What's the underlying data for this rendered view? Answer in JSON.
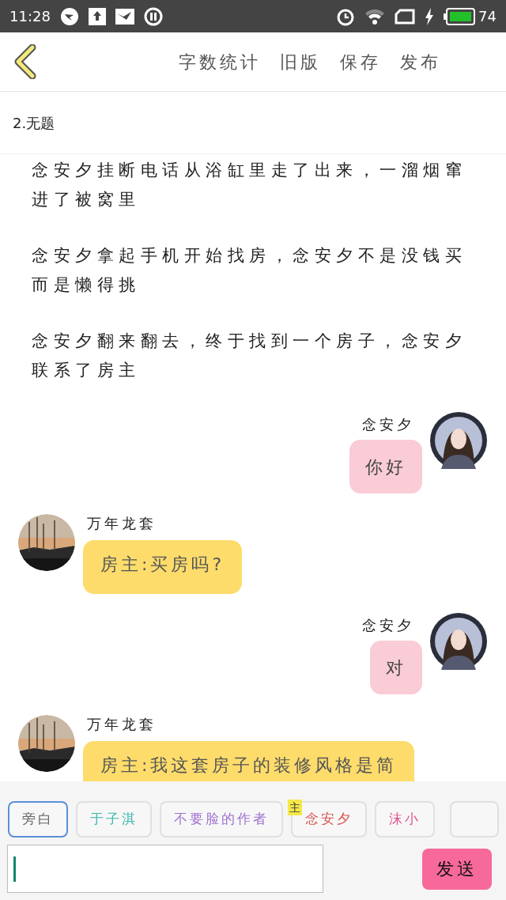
{
  "status_bar": {
    "time": "11:28",
    "battery": "74"
  },
  "toolbar": {
    "actions": [
      "字数统计",
      "旧版",
      "保存",
      "发布"
    ]
  },
  "chapter_title": "2.无题",
  "paragraphs": [
    "念安夕挂断电话从浴缸里走了出来，一溜烟窜进了被窝里",
    "念安夕拿起手机开始找房，念安夕不是没钱买而是懒得挑",
    "念安夕翻来翻去，终于找到一个房子，念安夕联系了房主"
  ],
  "messages": [
    {
      "kind": "self",
      "sender": "念安夕",
      "text": "你好"
    },
    {
      "kind": "other",
      "sender": "万年龙套",
      "text": "房主:买房吗?"
    },
    {
      "kind": "self",
      "sender": "念安夕",
      "text": "对"
    },
    {
      "kind": "other",
      "sender": "万年龙套",
      "text": "房主:我这套房子的装修风格是简"
    }
  ],
  "roles": [
    {
      "name": "旁白",
      "selected": true,
      "color": "#666666"
    },
    {
      "name": "于子淇",
      "selected": false,
      "color": "#3cb8a8"
    },
    {
      "name": "不要脸的作者",
      "selected": false,
      "color": "#a070d0"
    },
    {
      "name": "念安夕",
      "selected": false,
      "color": "#d9534f",
      "badge": "主"
    },
    {
      "name": "沫小",
      "selected": false,
      "color": "#e0508a"
    }
  ],
  "composer": {
    "send": "发送"
  }
}
